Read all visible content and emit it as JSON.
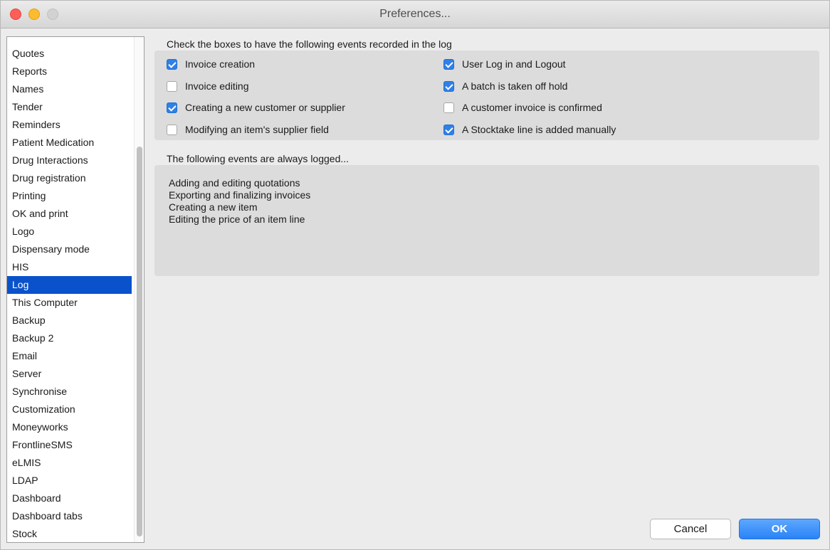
{
  "window": {
    "title": "Preferences..."
  },
  "sidebar": {
    "items": [
      {
        "label": "Quotes"
      },
      {
        "label": "Reports"
      },
      {
        "label": "Names"
      },
      {
        "label": "Tender"
      },
      {
        "label": "Reminders"
      },
      {
        "label": "Patient Medication"
      },
      {
        "label": "Drug Interactions"
      },
      {
        "label": "Drug registration"
      },
      {
        "label": "Printing"
      },
      {
        "label": "OK and print"
      },
      {
        "label": "Logo"
      },
      {
        "label": "Dispensary mode"
      },
      {
        "label": "HIS"
      },
      {
        "label": "Log"
      },
      {
        "label": "This Computer"
      },
      {
        "label": "Backup"
      },
      {
        "label": "Backup 2"
      },
      {
        "label": "Email"
      },
      {
        "label": "Server"
      },
      {
        "label": "Synchronise"
      },
      {
        "label": "Customization"
      },
      {
        "label": "Moneyworks"
      },
      {
        "label": "FrontlineSMS"
      },
      {
        "label": "eLMIS"
      },
      {
        "label": "LDAP"
      },
      {
        "label": "Dashboard"
      },
      {
        "label": "Dashboard tabs"
      },
      {
        "label": "Stock"
      }
    ],
    "selected": "Log"
  },
  "log": {
    "checks_heading": "Check the boxes to have the following events recorded in the log",
    "checkboxes": [
      {
        "label": "Invoice creation",
        "checked": true
      },
      {
        "label": "Invoice editing",
        "checked": false
      },
      {
        "label": "Creating a new customer or supplier",
        "checked": true
      },
      {
        "label": "Modifying an item's supplier field",
        "checked": false
      },
      {
        "label": "User Log in and Logout",
        "checked": true
      },
      {
        "label": "A batch is taken off hold",
        "checked": true
      },
      {
        "label": "A customer invoice is confirmed",
        "checked": false
      },
      {
        "label": "A Stocktake line is added manually",
        "checked": true
      }
    ],
    "always_heading": "The following events are always logged...",
    "always_events": [
      "Adding and editing quotations",
      "Exporting and finalizing invoices",
      "Creating a new item",
      "Editing the price of an item line"
    ]
  },
  "buttons": {
    "cancel": "Cancel",
    "ok": "OK"
  },
  "colors": {
    "selection": "#0a52cc",
    "checkbox_on": "#2f80e8",
    "ok_button": "#2a83f6"
  }
}
